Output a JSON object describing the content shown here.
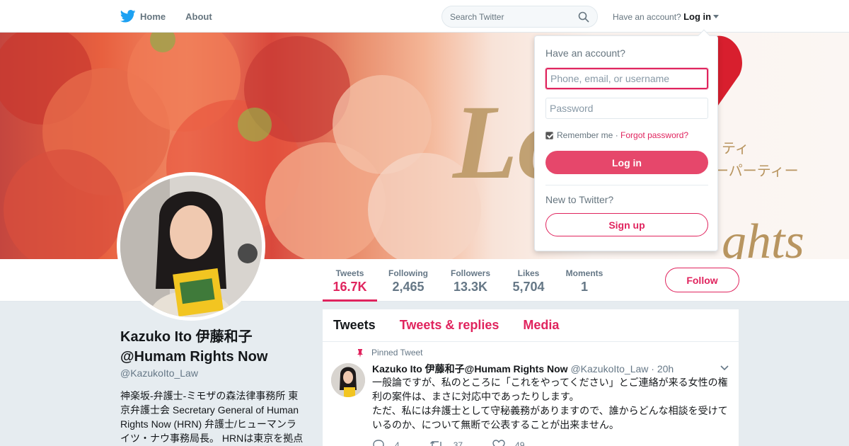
{
  "nav": {
    "home_label": "Home",
    "about_label": "About",
    "search_placeholder": "Search Twitter",
    "have_account": "Have an account?",
    "login_label": "Log in"
  },
  "colors": {
    "accent": "#e0245e",
    "brand_blue": "#1da1f2"
  },
  "profile": {
    "name": "Kazuko Ito 伊藤和子 @Humam Rights Now",
    "handle": "@KazukoIto_Law",
    "bio": "神楽坂-弁護士-ミモザの森法律事務所 東京弁護士会 Secretary General of Human Rights Now (HRN) 弁護士/ヒューマンライツ・ナウ事務局長。 HRNは東京を拠点"
  },
  "stats": [
    {
      "label": "Tweets",
      "value": "16.7K"
    },
    {
      "label": "Following",
      "value": "2,465"
    },
    {
      "label": "Followers",
      "value": "13.3K"
    },
    {
      "label": "Likes",
      "value": "5,704"
    },
    {
      "label": "Moments",
      "value": "1"
    }
  ],
  "follow_label": "Follow",
  "tabs": [
    "Tweets",
    "Tweets & replies",
    "Media"
  ],
  "tweet": {
    "pinned_label": "Pinned Tweet",
    "author": "Kazuko Ito 伊藤和子@Humam Rights Now",
    "handle": "@KazukoIto_Law",
    "time": "· 20h",
    "text_1": "一般論ですが、私のところに「これをやってください」とご連絡が来る女性の権利の案件は、まさに対応中であったりします。",
    "text_2": "ただ、私には弁護士として守秘義務がありますので、誰からどんな相談を受けているのか、について無断で公表することが出来ません。",
    "replies": "4",
    "retweets": "37",
    "likes": "49"
  },
  "login_dropdown": {
    "title": "Have an account?",
    "username_placeholder": "Phone, email, or username",
    "password_placeholder": "Password",
    "remember_label": "Remember me",
    "separator": "·",
    "forgot_label": "Forgot password?",
    "login_button": "Log in",
    "new_label": "New to Twitter?",
    "signup_button": "Sign up"
  }
}
